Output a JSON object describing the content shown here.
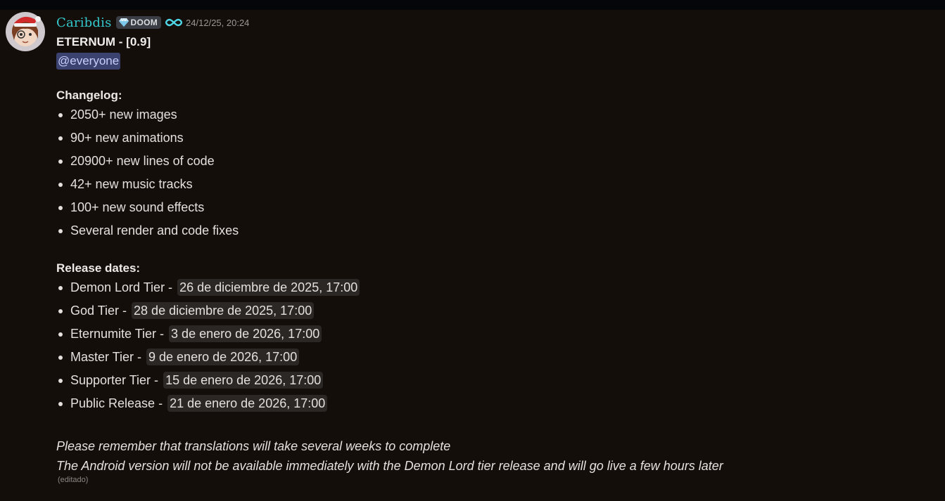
{
  "author": {
    "name": "Caribdis",
    "role_tag": "DOOM",
    "timestamp": "24/12/25, 20:24"
  },
  "message": {
    "title": "ETERNUM - [0.9]",
    "mention": "@everyone",
    "changelog_heading": "Changelog:",
    "changelog": [
      "2050+ new images",
      "90+ new animations",
      "20900+ new lines of code",
      "42+ new music tracks",
      "100+ new sound effects",
      "Several render and code fixes"
    ],
    "release_heading": "Release dates:",
    "releases": [
      {
        "tier": "Demon Lord Tier - ",
        "date": "26 de diciembre de 2025, 17:00"
      },
      {
        "tier": "God Tier - ",
        "date": "28 de diciembre de 2025, 17:00"
      },
      {
        "tier": "Eternumite Tier - ",
        "date": "3 de enero de 2026, 17:00"
      },
      {
        "tier": "Master Tier - ",
        "date": "9 de enero de 2026, 17:00"
      },
      {
        "tier": "Supporter Tier - ",
        "date": "15 de enero de 2026, 17:00"
      },
      {
        "tier": "Public Release - ",
        "date": "21 de enero de 2026, 17:00"
      }
    ],
    "note_1": "Please remember that translations will take several weeks to complete",
    "note_2": "The Android version will not be available immediately with the Demon Lord tier release and will go live a few hours later",
    "edited_label": "(editado)"
  },
  "icons": {
    "avatar": "avatar",
    "tag_icon": "gem-icon",
    "badge": "infinity-icon"
  },
  "colors": {
    "background": "#140e0b",
    "username": "#33c9cd",
    "mention_bg": "#3c4270",
    "mention_text": "#c9cdfb",
    "date_chip_bg": "#2b2724"
  }
}
